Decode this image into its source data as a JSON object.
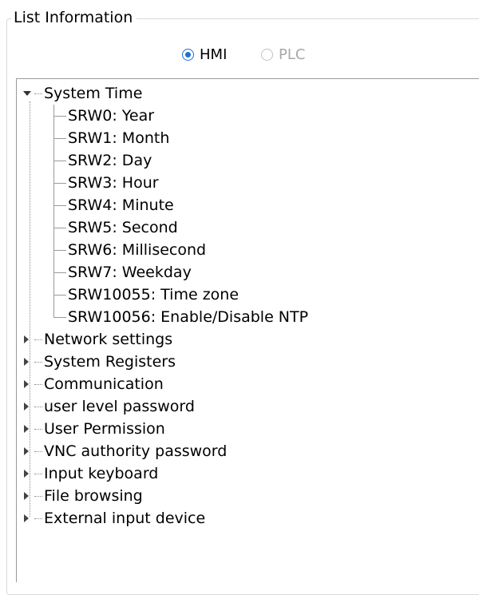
{
  "group": {
    "title": "List Information"
  },
  "mode": {
    "options": [
      {
        "label": "HMI",
        "selected": true,
        "enabled": true
      },
      {
        "label": "PLC",
        "selected": false,
        "enabled": false
      }
    ]
  },
  "tree": {
    "expanded_node": {
      "label": "System Time",
      "children": [
        "SRW0:  Year",
        "SRW1:  Month",
        "SRW2:  Day",
        "SRW3:  Hour",
        "SRW4:  Minute",
        "SRW5:  Second",
        "SRW6:  Millisecond",
        "SRW7:  Weekday",
        "SRW10055:  Time zone",
        "SRW10056:  Enable/Disable NTP"
      ]
    },
    "collapsed_nodes": [
      "Network settings",
      "System Registers",
      "Communication",
      "user level password",
      "User Permission",
      "VNC authority password",
      "Input keyboard",
      "File browsing",
      "External input device"
    ]
  },
  "colors": {
    "radio_accent": "#1f6fd6",
    "disabled_text": "#a8a8a8",
    "border": "#9a9a9a"
  }
}
